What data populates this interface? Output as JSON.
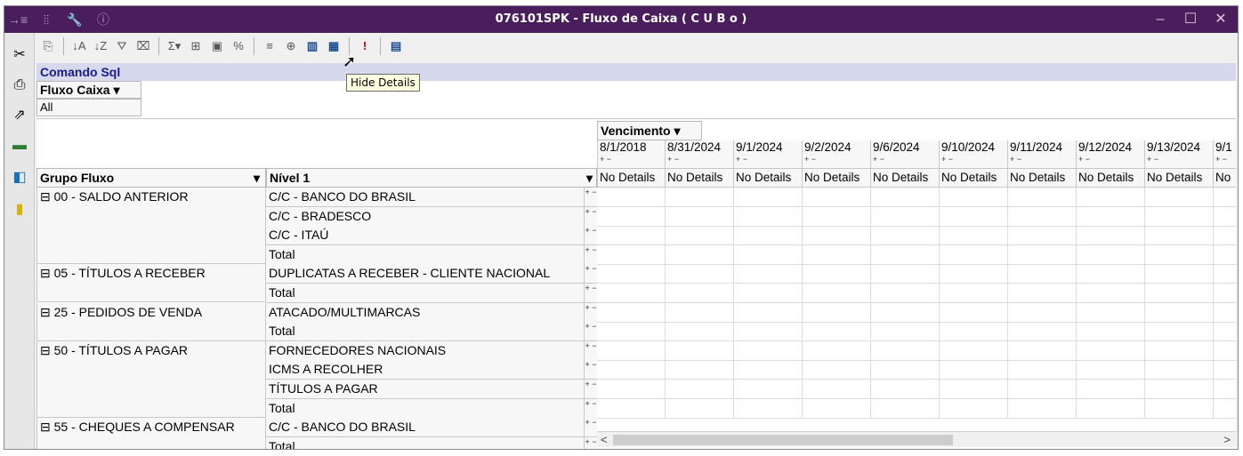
{
  "window": {
    "title": "076101SPK - Fluxo de Caixa ( C U B o )",
    "left_icons": [
      "→≡",
      "⦙⦙",
      "🔧",
      "ⓘ"
    ],
    "controls": [
      "–",
      "☐",
      "✕"
    ]
  },
  "left_strip": [
    "scissors-icon",
    "print-icon",
    "export-icon",
    "chart-icon",
    "excel-icon",
    "new-icon"
  ],
  "toolbar": {
    "buttons": [
      {
        "name": "copy-icon",
        "glyph": "⎘"
      },
      {
        "sep": true
      },
      {
        "name": "sort-asc-icon",
        "glyph": "↓A"
      },
      {
        "name": "sort-desc-icon",
        "glyph": "↓Z"
      },
      {
        "name": "filter-icon",
        "glyph": "⛛"
      },
      {
        "name": "filter-clear-icon",
        "glyph": "⌧"
      },
      {
        "sep": true
      },
      {
        "name": "sum-icon",
        "glyph": "Σ▾"
      },
      {
        "name": "tree-icon",
        "glyph": "⊞"
      },
      {
        "name": "chart-toggle-icon",
        "glyph": "▣"
      },
      {
        "name": "percent-icon",
        "glyph": "%"
      },
      {
        "sep": true
      },
      {
        "name": "show-details-icon",
        "glyph": "≡"
      },
      {
        "name": "expand-icon",
        "glyph": "⊕"
      },
      {
        "name": "hide-details-icon",
        "glyph": "▥",
        "hi": true
      },
      {
        "name": "details-grid-icon",
        "glyph": "▦",
        "hi": true
      },
      {
        "sep": true
      },
      {
        "name": "alert-icon",
        "glyph": "!",
        "red": true
      },
      {
        "sep": true
      },
      {
        "name": "calendar-icon",
        "glyph": "▤",
        "hi": true
      }
    ],
    "tooltip": "Hide Details"
  },
  "sql_label": "Comando Sql",
  "filter": {
    "field": "Fluxo Caixa ▾",
    "value": "All"
  },
  "column_field": "Vencimento ▾",
  "row_fields": {
    "grupo": "Grupo Fluxo",
    "nivel": "Nível 1",
    "dropdown": "▾"
  },
  "dates": [
    "8/1/2018",
    "8/31/2024",
    "9/1/2024",
    "9/2/2024",
    "9/6/2024",
    "9/10/2024",
    "9/11/2024",
    "9/12/2024",
    "9/13/2024",
    "9/1"
  ],
  "date_pm": "+ −",
  "no_details": "No Details",
  "no_details_partial": "No",
  "pm_symbol": "+ −",
  "groups": [
    {
      "label": "⊟ 00  - SALDO ANTERIOR",
      "rows": [
        "C/C - BANCO DO BRASIL",
        "C/C - BRADESCO",
        "C/C - ITAÚ",
        "Total"
      ]
    },
    {
      "label": "⊟ 05  - TÍTULOS A RECEBER",
      "rows": [
        "DUPLICATAS A RECEBER - CLIENTE NACIONAL",
        "Total"
      ]
    },
    {
      "label": "⊟ 25  - PEDIDOS DE VENDA",
      "rows": [
        "ATACADO/MULTIMARCAS",
        "Total"
      ]
    },
    {
      "label": "⊟ 50  - TÍTULOS A PAGAR",
      "rows": [
        "FORNECEDORES NACIONAIS",
        "ICMS A RECOLHER",
        "TÍTULOS A PAGAR",
        "Total"
      ]
    },
    {
      "label": "⊟ 55  - CHEQUES A COMPENSAR",
      "rows": [
        "C/C - BANCO DO BRASIL",
        "Total"
      ]
    }
  ],
  "scroll": {
    "left": "<",
    "right": ">"
  }
}
